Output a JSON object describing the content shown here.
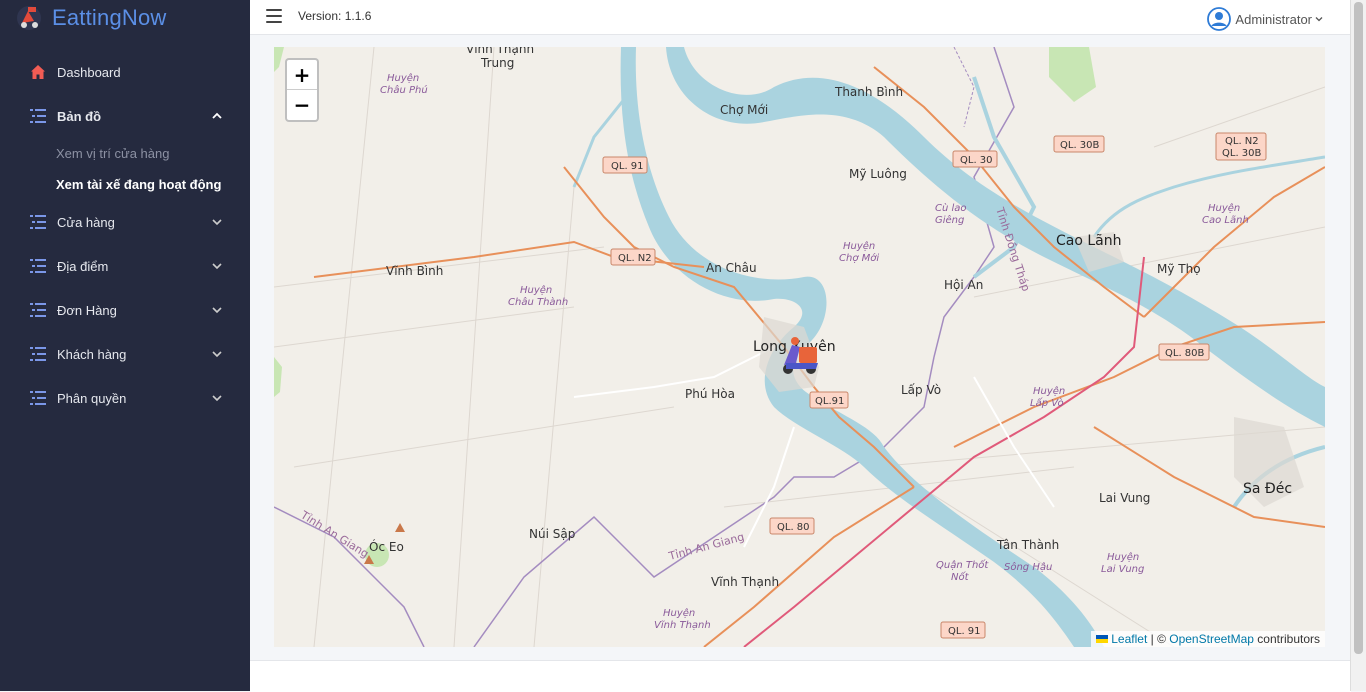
{
  "brand": {
    "name": "EattingNow"
  },
  "header": {
    "version": "Version: 1.1.6",
    "user": "Administrator"
  },
  "sidebar": {
    "items": [
      {
        "label": "Dashboard",
        "icon": "home-icon"
      },
      {
        "label": "Bản đồ",
        "icon": "list-icon",
        "open": true,
        "children": [
          {
            "label": "Xem vị trí cửa hàng"
          },
          {
            "label": "Xem tài xế đang hoạt động",
            "active": true
          }
        ]
      },
      {
        "label": "Cửa hàng",
        "icon": "list-icon"
      },
      {
        "label": "Địa điểm",
        "icon": "list-icon"
      },
      {
        "label": "Đơn Hàng",
        "icon": "list-icon"
      },
      {
        "label": "Khách hàng",
        "icon": "list-icon"
      },
      {
        "label": "Phân quyền",
        "icon": "list-icon"
      }
    ]
  },
  "map": {
    "zoom_in": "+",
    "zoom_out": "−",
    "attribution": {
      "leaflet": "Leaflet",
      "sep": " | © ",
      "osm": "OpenStreetMap",
      "suffix": " contributors"
    },
    "places": {
      "vinh_thanh_trung_1": "Vĩnh Thạnh",
      "vinh_thanh_trung_2": "Trung",
      "cho_moi": "Chợ Mới",
      "thanh_binh": "Thanh Bình",
      "my_luong": "Mỹ Luông",
      "cu_lao_1": "Cù lao",
      "cu_lao_2": "Giêng",
      "cao_lanh": "Cao Lãnh",
      "my_tho": "Mỹ Thọ",
      "vinh_binh": "Vĩnh Bình",
      "an_chau": "An Châu",
      "hoi_an": "Hội An",
      "long_xuyen": "Long Xuyên",
      "phu_hoa": "Phú Hòa",
      "lap_vo": "Lấp Vò",
      "sa_dec": "Sa Đéc",
      "lai_vung": "Lai Vung",
      "nui_sap": "Núi Sập",
      "oc_eo": "Óc Eo",
      "tan_thanh": "Tân Thành",
      "vinh_thanh": "Vĩnh Thạnh",
      "song_hau": "Sông Hậu"
    },
    "districts": {
      "chau_phu_1": "Huyện",
      "chau_phu_2": "Châu Phú",
      "cho_moi_1": "Huyện",
      "cho_moi_2": "Chợ Mới",
      "chau_thanh_1": "Huyện",
      "chau_thanh_2": "Châu Thành",
      "cao_lanh_1": "Huyện",
      "cao_lanh_2": "Cao Lãnh",
      "lap_vo_1": "Huyện",
      "lap_vo_2": "Lấp Vò",
      "lai_vung_1": "Huyện",
      "lai_vung_2": "Lai Vung",
      "vinh_thanh_1": "Huyện",
      "vinh_thanh_2": "Vĩnh Thạnh",
      "thot_not_1": "Quận Thốt",
      "thot_not_2": "Nốt"
    },
    "provinces": {
      "an_giang_1": "Tỉnh An Giang",
      "an_giang_2": "Tỉnh An Giang",
      "dong_thap": "Tỉnh Đồng Tháp"
    },
    "roads": {
      "ql91_a": "QL. 91",
      "qln2_a": "QL. N2",
      "ql30": "QL. 30",
      "ql30b": "QL. 30B",
      "qln2_b_1": "QL. N2",
      "qln2_b_2": "QL. 30B",
      "ql80b": "QL. 80B",
      "ql91_b": "QL.91",
      "ql80": "QL. 80",
      "ql91_c": "QL. 91"
    }
  }
}
